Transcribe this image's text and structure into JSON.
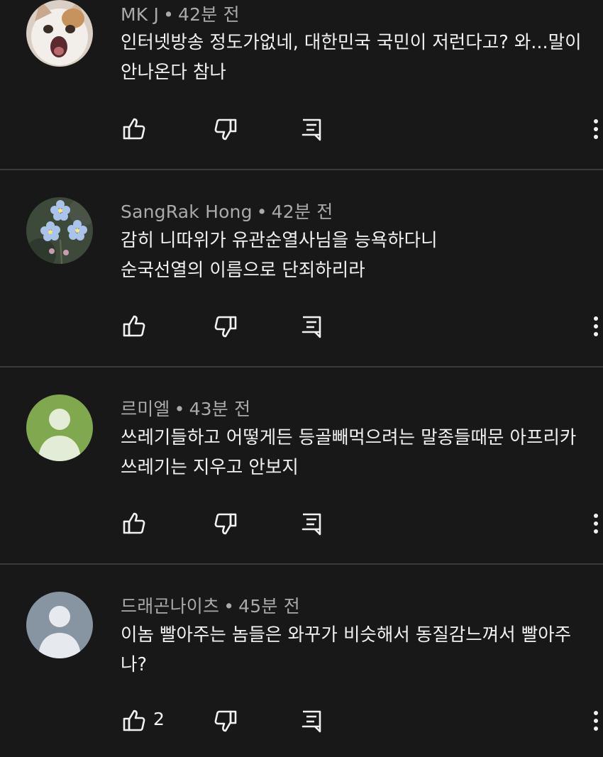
{
  "colors": {
    "background": "#181818",
    "divider": "#3a3a3a",
    "meta_text": "#aaaaaa",
    "body_text": "#f1f1f1",
    "avatar_green": "#7fa84f",
    "avatar_slate": "#8795a3"
  },
  "comments": [
    {
      "author": "MK J",
      "sep": "•",
      "time": "42분 전",
      "lines": [
        "인터넷방송 정도가없네, 대한민국 국민이 저런다고? 와...말이",
        "안나온다 참나"
      ],
      "likes": "",
      "avatar": "cat-photo"
    },
    {
      "author": "SangRak Hong",
      "sep": "•",
      "time": "42분 전",
      "lines": [
        "감히 니따위가 유관순열사님을 능욕하다니",
        "순국선열의 이름으로 단죄하리라"
      ],
      "likes": "",
      "avatar": "forget-me-not-photo"
    },
    {
      "author": "르미엘",
      "sep": "•",
      "time": "43분 전",
      "lines": [
        "쓰레기들하고 어떻게든 등골빼먹으려는 말종들때문 아프리카",
        "쓰레기는 지우고 안보지"
      ],
      "likes": "",
      "avatar": "default-person-green"
    },
    {
      "author": "드래곤나이츠",
      "sep": "•",
      "time": "45분 전",
      "lines": [
        "이놈 빨아주는 놈들은 와꾸가 비슷해서 동질감느껴서 빨아주",
        "나?"
      ],
      "likes": "2",
      "avatar": "default-person-slate"
    }
  ],
  "icons": {
    "like": "thumb-up-icon",
    "dislike": "thumb-down-icon",
    "reply": "reply-comment-icon",
    "more": "more-vertical-icon"
  }
}
